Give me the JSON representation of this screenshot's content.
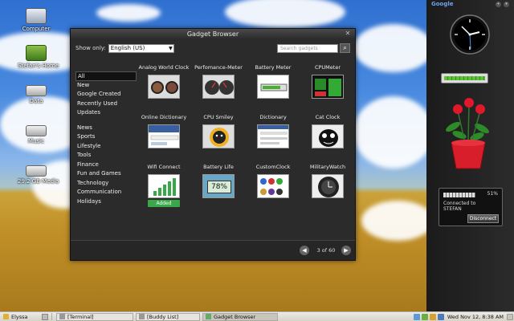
{
  "desktop": {
    "icons": [
      {
        "label": "Computer"
      },
      {
        "label": "Stefan's Home"
      },
      {
        "label": "Data"
      },
      {
        "label": "Music"
      },
      {
        "label": "29.2 GB Media"
      }
    ]
  },
  "gadget_browser": {
    "title": "Gadget Browser",
    "show_only_label": "Show only:",
    "language_value": "English (US)",
    "search_placeholder": "Search gadgets",
    "categories": [
      "All",
      "New",
      "Google Created",
      "Recently Used",
      "Updates"
    ],
    "categories2": [
      "News",
      "Sports",
      "Lifestyle",
      "Tools",
      "Finance",
      "Fun and Games",
      "Technology",
      "Communication",
      "Holidays"
    ],
    "gadgets": [
      {
        "name": "Analog World Clock"
      },
      {
        "name": "Perfomance-Meter"
      },
      {
        "name": "Battery Meter"
      },
      {
        "name": "CPUMeter"
      },
      {
        "name": "Online Dictionary"
      },
      {
        "name": "CPU Smiley"
      },
      {
        "name": "Dictionary"
      },
      {
        "name": "Cat Clock"
      },
      {
        "name": "Wifi Connect"
      },
      {
        "name": "Battery Life"
      },
      {
        "name": "CustomClock"
      },
      {
        "name": "MilitaryWatch"
      }
    ],
    "added_label": "Added",
    "battery_life_value": "78%",
    "page_text": "3 of 60"
  },
  "sidebar": {
    "logo": "Google",
    "wifi_percent": "51%",
    "wifi_status": "Connected to",
    "wifi_network": "STEFAN",
    "disconnect_label": "Disconnect"
  },
  "taskbar": {
    "user": "Elyssa",
    "terminal": "[Terminal]",
    "buddy_list": "[Buddy List]",
    "gadget_browser": "Gadget Browser",
    "date": "Wed Nov 12,",
    "time": "8:38 AM"
  },
  "colors": {
    "window_bg": "#2b2b2b",
    "added_green": "#3aa84a",
    "taskbar_bg": "#dcd9cf"
  }
}
